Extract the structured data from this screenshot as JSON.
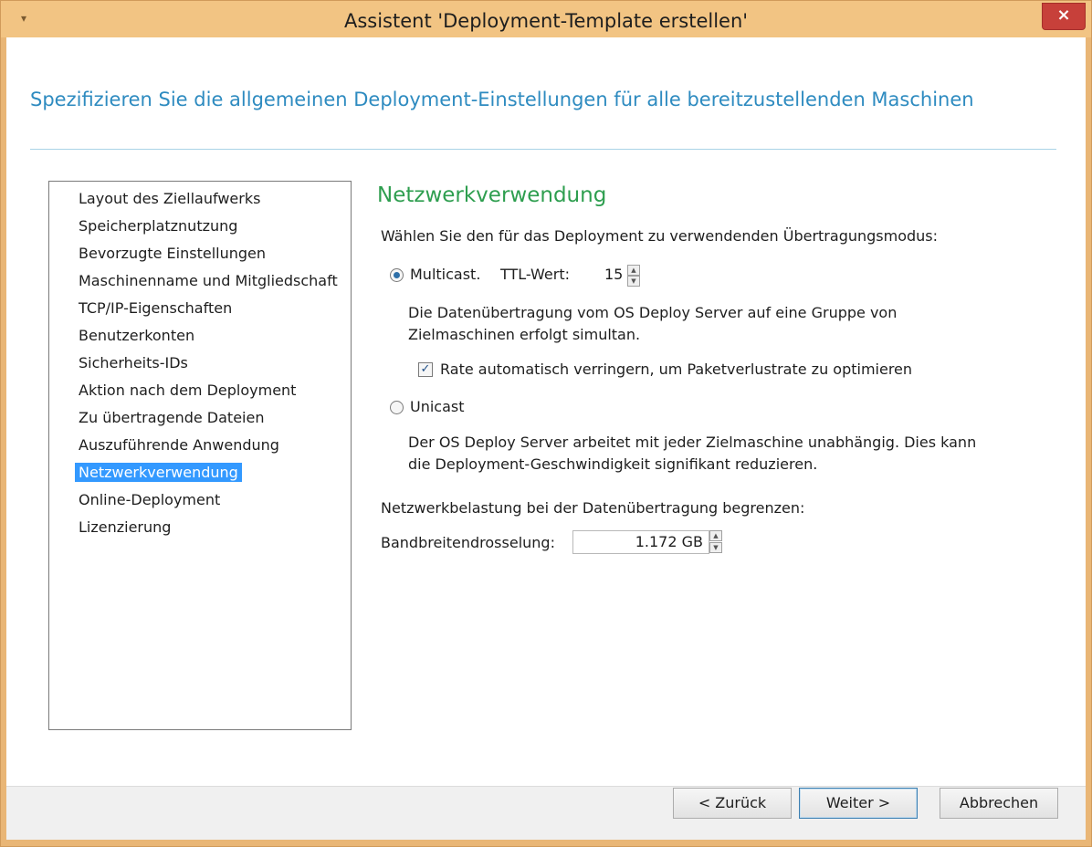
{
  "window": {
    "title": "Assistent 'Deployment-Template erstellen'",
    "close_glyph": "×",
    "menu_glyph": "▾"
  },
  "header": {
    "heading": "Spezifizieren Sie die allgemeinen Deployment-Einstellungen für alle bereitzustellenden Maschinen"
  },
  "nav": {
    "items": [
      "Layout des Ziellaufwerks",
      "Speicherplatznutzung",
      "Bevorzugte Einstellungen",
      "Maschinenname und Mitgliedschaft",
      "TCP/IP-Eigenschaften",
      "Benutzerkonten",
      "Sicherheits-IDs",
      "Aktion nach dem Deployment",
      "Zu übertragende Dateien",
      "Auszuführende Anwendung",
      "Netzwerkverwendung",
      "Online-Deployment",
      "Lizenzierung"
    ],
    "selected": "Netzwerkverwendung"
  },
  "panel": {
    "title": "Netzwerkverwendung",
    "prompt": "Wählen Sie den für das Deployment zu verwendenden Übertragungsmodus:",
    "multicast": {
      "label": "Multicast.",
      "selected": true,
      "ttl_label": "TTL-Wert:",
      "ttl_value": "15",
      "desc_line1": "Die Datenübertragung vom OS Deploy Server auf eine Gruppe von",
      "desc_line2": "Zielmaschinen erfolgt simultan.",
      "rate_checkbox_label": "Rate automatisch verringern, um Paketverlustrate zu optimieren",
      "rate_checked": true
    },
    "unicast": {
      "label": "Unicast",
      "selected": false,
      "desc_line1": "Der OS Deploy Server arbeitet mit jeder Zielmaschine unabhängig. Dies kann",
      "desc_line2": "die Deployment-Geschwindigkeit signifikant reduzieren."
    },
    "limit_label": "Netzwerkbelastung bei der Datenübertragung begrenzen:",
    "bandwidth_label": "Bandbreitendrosselung:",
    "bandwidth_value": "1.172 GB"
  },
  "footer": {
    "back": "< Zurück",
    "next": "Weiter >",
    "cancel": "Abbrechen"
  },
  "colors": {
    "accent_heading": "#2e8bc0",
    "section_title": "#2e9e4f",
    "selection": "#3399ff",
    "window_frame": "#f2c483",
    "close_button": "#c7403a"
  }
}
